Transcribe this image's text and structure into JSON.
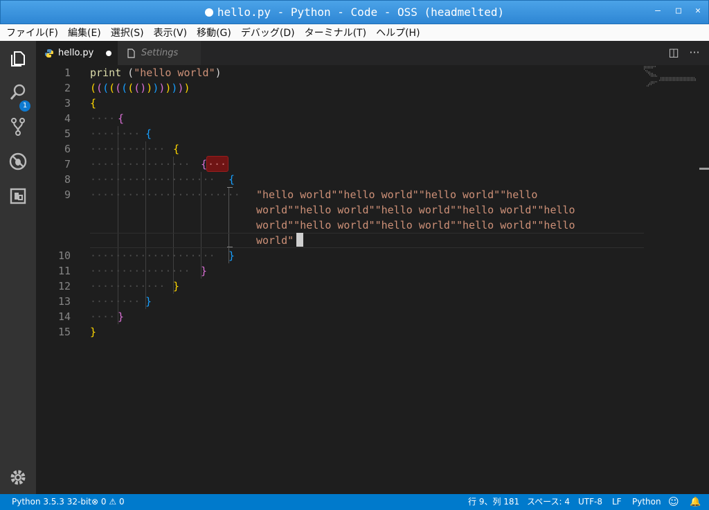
{
  "window": {
    "title": "hello.py - Python - Code - OSS (headmelted)",
    "controls": [
      "—",
      "□",
      "✕"
    ]
  },
  "menu": [
    "ファイル(F)",
    "編集(E)",
    "選択(S)",
    "表示(V)",
    "移動(G)",
    "デバッグ(D)",
    "ターミナル(T)",
    "ヘルプ(H)"
  ],
  "activity": {
    "explorer_badge": "1",
    "icons": [
      "files-icon",
      "search-icon",
      "source-control-icon",
      "debug-icon",
      "extensions-icon",
      "gear-icon"
    ]
  },
  "tabs": [
    {
      "label": "hello.py",
      "dirty": true
    },
    {
      "label": "Settings",
      "dirty": false
    }
  ],
  "editor": {
    "lines": [
      {
        "num": "1"
      },
      {
        "num": "2"
      },
      {
        "num": "3"
      },
      {
        "num": "4"
      },
      {
        "num": "5"
      },
      {
        "num": "6"
      },
      {
        "num": "7"
      },
      {
        "num": "8"
      },
      {
        "num": "9"
      },
      {
        "num": "10"
      },
      {
        "num": "11"
      },
      {
        "num": "12"
      },
      {
        "num": "13"
      },
      {
        "num": "14"
      },
      {
        "num": "15"
      }
    ],
    "line1": {
      "keyword": "print",
      "open": " (",
      "string": "\"hello world\"",
      "close": ")"
    },
    "line2": [
      "(",
      "(",
      "(",
      "(",
      "(",
      "(",
      "(",
      "(",
      ")",
      ")",
      ")",
      ")",
      ")",
      ")",
      ")",
      ")"
    ],
    "line9_wrapped": [
      "\"hello world\"\"hello world\"\"hello world\"\"hello",
      "world\"\"hello world\"\"hello world\"\"hello world\"\"hello",
      "world\"\"hello world\"\"hello world\"\"hello world\"\"hello",
      "world\""
    ],
    "brace_open": "{",
    "brace_close": "}",
    "dot": "·"
  },
  "status": {
    "interpreter": "Python 3.5.3 32-bit",
    "errors": "0",
    "warnings": "0",
    "position": "行 9、列 181",
    "indent": "スペース: 4",
    "encoding": "UTF-8",
    "eol": "LF",
    "language": "Python"
  },
  "colors": {
    "accent": "#007acc",
    "editor_bg": "#1e1e1e",
    "activity_bg": "#333333",
    "string": "#ce9178",
    "gold": "#ffd700",
    "orchid": "#da70d6",
    "blue": "#179fff"
  }
}
